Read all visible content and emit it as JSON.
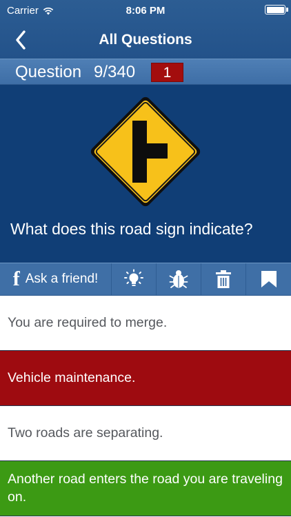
{
  "status_bar": {
    "carrier": "Carrier",
    "time": "8:06 PM",
    "wifi_icon": "wifi-icon",
    "battery_icon": "battery-icon"
  },
  "nav": {
    "title": "All Questions",
    "back_icon": "chevron-left-icon"
  },
  "question_header": {
    "label": "Question",
    "count": "9/340",
    "badge": "1"
  },
  "question": {
    "sign_icon": "side-road-sign-icon",
    "text": "What does this road sign indicate?"
  },
  "toolbar": {
    "ask_label": "Ask a friend!",
    "fb_glyph": "f",
    "icons": [
      "lightbulb-icon",
      "bug-icon",
      "trash-icon",
      "bookmark-icon"
    ]
  },
  "answers": [
    {
      "text": "You are required to merge.",
      "state": "neutral"
    },
    {
      "text": "Vehicle maintenance.",
      "state": "wrong"
    },
    {
      "text": "Two roads are separating.",
      "state": "neutral"
    },
    {
      "text": "Another road enters the road you are traveling on.",
      "state": "correct"
    }
  ],
  "colors": {
    "nav_bg": "#23528a",
    "question_bg": "#103e76",
    "header_bg": "#3e6ea6",
    "wrong": "#9e0b10",
    "correct": "#3c9a14",
    "sign_yellow": "#f7c11a"
  }
}
